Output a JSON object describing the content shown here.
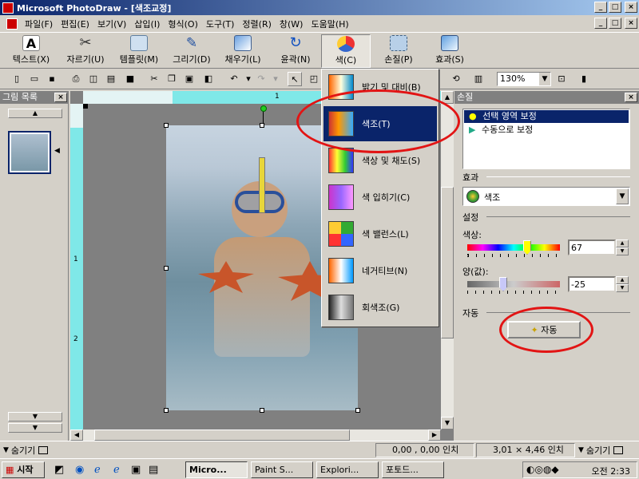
{
  "window": {
    "title": "Microsoft PhotoDraw - [색조교정]",
    "caption_buttons": [
      "_",
      "□",
      "×"
    ]
  },
  "menu": [
    "파일(F)",
    "편집(E)",
    "보기(V)",
    "삽입(I)",
    "형식(O)",
    "도구(T)",
    "정렬(R)",
    "창(W)",
    "도움말(H)"
  ],
  "big_toolbar": [
    {
      "label": "텍스트(X)",
      "icon": "text-icon"
    },
    {
      "label": "자르기(U)",
      "icon": "scissors-icon"
    },
    {
      "label": "템플릿(M)",
      "icon": "template-icon"
    },
    {
      "label": "그리기(D)",
      "icon": "pencil-icon"
    },
    {
      "label": "채우기(L)",
      "icon": "fill-bucket-icon"
    },
    {
      "label": "윤곽(N)",
      "icon": "outline-icon"
    },
    {
      "label": "색(C)",
      "icon": "color-icon"
    },
    {
      "label": "손질(P)",
      "icon": "touchup-icon"
    },
    {
      "label": "효과(S)",
      "icon": "effects-icon"
    }
  ],
  "small_toolbar": {
    "zoom": "130%"
  },
  "left_panel": {
    "title": "그림 목록",
    "close": "×"
  },
  "ruler": {
    "top_mark": "1",
    "side_marks": [
      "1",
      "2"
    ]
  },
  "color_menu": {
    "items": [
      {
        "label": "밝기 및 대비(B)"
      },
      {
        "label": "색조(T)"
      },
      {
        "label": "색상 및 채도(S)"
      },
      {
        "label": "색 입히기(C)"
      },
      {
        "label": "색 밸런스(L)"
      },
      {
        "label": "네거티브(N)"
      },
      {
        "label": "회색조(G)"
      }
    ],
    "selected_index": 1
  },
  "right_panel": {
    "title": "손질",
    "close": "×",
    "modes": [
      "선택 영역 보정",
      "수동으로 보정"
    ],
    "effect_label": "효과",
    "effect_value": "색조",
    "settings_label": "설정",
    "hue_label": "색상:",
    "hue_value": "67",
    "amount_label": "양(값):",
    "amount_value": "-25",
    "auto_label": "자동",
    "auto_button": "자동"
  },
  "status": {
    "hide_left": "숨기기",
    "position": "0,00 , 0,00 인치",
    "size": "3,01 × 4,46 인치",
    "hide_right": "숨기기"
  },
  "taskbar": {
    "start": "시작",
    "tasks": [
      "Micro...",
      "Paint S...",
      "Explori...",
      "포토드..."
    ],
    "clock": "오전 2:33"
  },
  "colors": {
    "title_active": "#0a246a",
    "ruler": "#7fe8e8",
    "highlight_ellipse": "#e21414"
  }
}
